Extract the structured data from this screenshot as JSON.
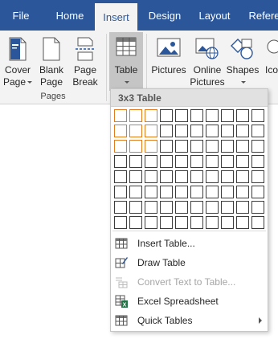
{
  "tabs": [
    {
      "label": "File"
    },
    {
      "label": "Home"
    },
    {
      "label": "Insert"
    },
    {
      "label": "Design"
    },
    {
      "label": "Layout"
    },
    {
      "label": "Refere"
    }
  ],
  "ribbon": {
    "buttons": {
      "cover_page": {
        "line1": "Cover",
        "line2": "Page"
      },
      "blank_page": {
        "line1": "Blank",
        "line2": "Page"
      },
      "page_break": {
        "line1": "Page",
        "line2": "Break"
      },
      "table": {
        "line1": "Table"
      },
      "pictures": {
        "line1": "Pictures"
      },
      "online_pictures": {
        "line1": "Online",
        "line2": "Pictures"
      },
      "shapes": {
        "line1": "Shapes"
      },
      "icons": {
        "line1": "Ico"
      }
    },
    "group_pages_label": "Pages"
  },
  "table_dropdown": {
    "header": "3x3 Table",
    "grid": {
      "columns": 10,
      "rows": 8,
      "selected_columns": 3,
      "selected_rows": 3
    },
    "menu": [
      {
        "label": "Insert Table...",
        "icon": "insert-table-icon",
        "disabled": false
      },
      {
        "label": "Draw Table",
        "icon": "draw-table-icon",
        "disabled": false
      },
      {
        "label": "Convert Text to Table...",
        "icon": "convert-text-icon",
        "disabled": true
      },
      {
        "label": "Excel Spreadsheet",
        "icon": "excel-icon",
        "disabled": false
      },
      {
        "label": "Quick Tables",
        "icon": "quick-tables-icon",
        "disabled": false,
        "submenu": true
      }
    ]
  },
  "colors": {
    "tab_bar": "#2b579a",
    "ribbon_bg": "#f3f3f3",
    "grid_highlight": "#e07b1e"
  }
}
